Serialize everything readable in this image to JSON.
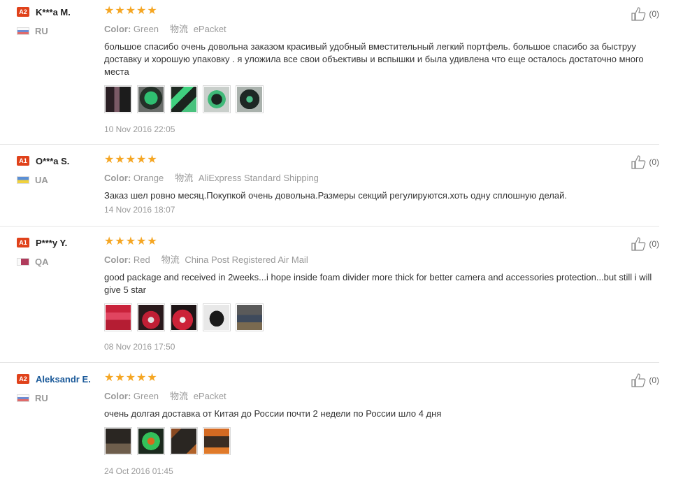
{
  "icons": {
    "badge": "level-badge",
    "star": "star-icon",
    "flag": "country-flag-icon",
    "helpful": "thumbs-up-icon"
  },
  "colors": {
    "star": "#f5a623",
    "badge": "#e0421b",
    "link": "#1a5999"
  },
  "labels": {
    "color": "Color:",
    "logistics": "物流"
  },
  "reviews": [
    {
      "level": "A2",
      "name": "K***a M.",
      "country": "RU",
      "flag": "ru",
      "rating": 5,
      "color": "Green",
      "shipping": "ePacket",
      "text": "большое спасибо очень довольна заказом красивый удобный вместительный легкий портфель. большое спасибо за быструу доставку и хорошую упаковку . я уложила все свои объективы и вспышки и была удивлена что еще осталось достаточно много места",
      "photos": 5,
      "date": "10 Nov 2016 22:05",
      "helpful": "(0)"
    },
    {
      "level": "A1",
      "name": "O***a S.",
      "country": "UA",
      "flag": "ua",
      "rating": 5,
      "color": "Orange",
      "shipping": "AliExpress Standard Shipping",
      "text": "Заказ шел ровно месяц.Покупкой очень довольна.Размеры секций регулируются.хоть одну сплошную делай.",
      "photos": 0,
      "date": "14 Nov 2016 18:07",
      "helpful": "(0)"
    },
    {
      "level": "A1",
      "name": "P***y Y.",
      "country": "QA",
      "flag": "qa",
      "rating": 5,
      "color": "Red",
      "shipping": "China Post Registered Air Mail",
      "text": "good package and received in 2weeks...i hope inside foam divider more thick for better camera and accessories protection...but still i will give 5 star",
      "photos": 5,
      "date": "08 Nov 2016 17:50",
      "helpful": "(0)"
    },
    {
      "level": "A2",
      "name": "Aleksandr E.",
      "country": "RU",
      "flag": "ru",
      "rating": 5,
      "color": "Green",
      "shipping": "ePacket",
      "text": "очень долгая доставка от Китая до России почти 2 недели по России шло 4 дня",
      "photos": 4,
      "date": "24 Oct 2016 01:45",
      "helpful": "(0)"
    }
  ]
}
